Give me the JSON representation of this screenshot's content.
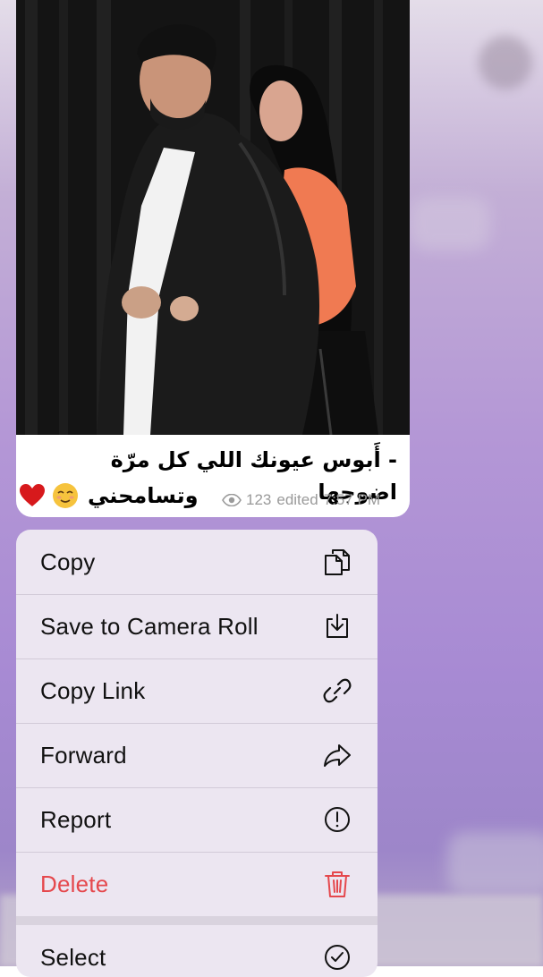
{
  "message": {
    "caption_line1": "- أَبوس عيونك اللي كل مرّة اضوجها",
    "caption_line2": "وتسامحني",
    "emojis": [
      "relieved-face",
      "red-heart"
    ],
    "views": "123",
    "edited_label": "edited",
    "time": "7:57 PM"
  },
  "context_menu": {
    "items": [
      {
        "label": "Copy",
        "icon": "copy-icon"
      },
      {
        "label": "Save to Camera Roll",
        "icon": "download-icon"
      },
      {
        "label": "Copy Link",
        "icon": "link-icon"
      },
      {
        "label": "Forward",
        "icon": "forward-icon"
      },
      {
        "label": "Report",
        "icon": "report-icon"
      },
      {
        "label": "Delete",
        "icon": "trash-icon",
        "color": "#e5484d"
      },
      {
        "label": "Select",
        "icon": "check-circle-icon"
      }
    ]
  },
  "colors": {
    "destructive": "#e5484d",
    "menu_background": "#ece6f1",
    "meta_text": "#9a9a9a"
  }
}
